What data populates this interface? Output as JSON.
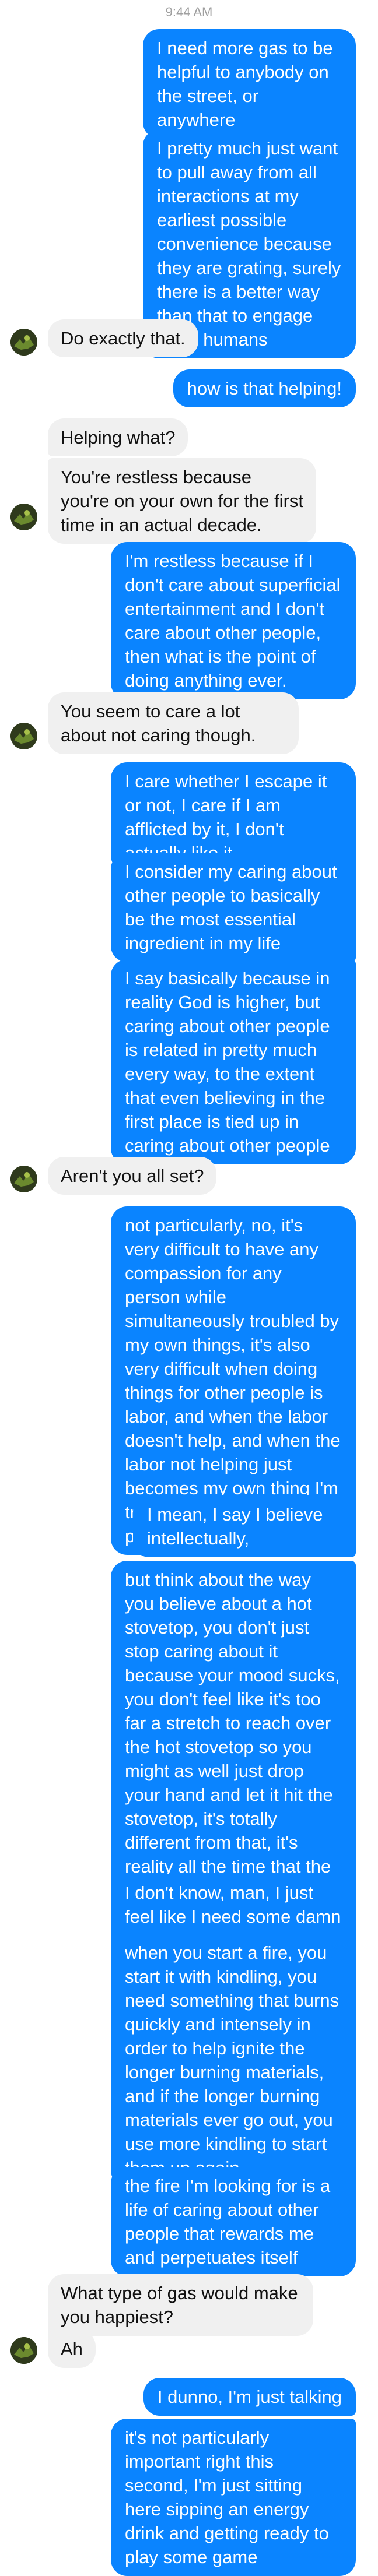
{
  "status": {
    "time": "9:44 AM"
  },
  "contact": {
    "avatar_icon": "contact-avatar-icon"
  },
  "colors": {
    "outgoing_bubble": "#0a84ff",
    "incoming_bubble": "#f0f0f0"
  },
  "messages": [
    {
      "sender": "me",
      "text": "I need more gas to be helpful to anybody on the street, or anywhere"
    },
    {
      "sender": "me",
      "text": "I pretty much just want to pull away from all interactions at my earliest possible convenience because they are grating, surely there is a better way than that to engage other humans"
    },
    {
      "sender": "them",
      "text": "Do exactly that."
    },
    {
      "sender": "me",
      "text": "how is that helping!"
    },
    {
      "sender": "them",
      "text": "Helping what?"
    },
    {
      "sender": "them",
      "text": "You're restless because you're on your own for the first time in an actual decade."
    },
    {
      "sender": "me",
      "text": "I'm restless because if I don't care about superficial entertainment and I don't care about other people, then what is the point of doing anything ever."
    },
    {
      "sender": "them",
      "text": "You seem to care a lot about not caring though."
    },
    {
      "sender": "me",
      "text": "I care whether I escape it or not, I care if I am afflicted by it, I don't actually like it"
    },
    {
      "sender": "me",
      "text": "I consider my caring about other people to basically be the most essential ingredient in my life"
    },
    {
      "sender": "me",
      "text": "I say basically because in reality God is higher, but caring about other people is related in pretty much every way, to the extent that even believing in the first place is tied up in caring about other people"
    },
    {
      "sender": "them",
      "text": "Aren't you all set?"
    },
    {
      "sender": "me",
      "text": "not particularly, no, it's very difficult to have any compassion for any person while simultaneously troubled by my own things, it's also very difficult when doing things for other people is labor, and when the labor doesn't help, and when the labor not helping just becomes my own thing I'm troubled by, I don't feel particularly set, no"
    },
    {
      "sender": "me",
      "text": "I mean, I say I believe intellectually,"
    },
    {
      "sender": "me",
      "text": "but think about the way you believe about a hot stovetop, you don't just stop caring about it because your mood sucks, you don't feel like it's too far a stretch to reach over the hot stovetop so you might as well just drop your hand and let it hit the stovetop, it's totally different from that, it's reality all the time that the stovetop is hot, and you always want to avoid it no matter what"
    },
    {
      "sender": "me",
      "text": "I don't know, man, I just feel like I need some damn gas"
    },
    {
      "sender": "me",
      "text": "when you start a fire, you start it with kindling, you need something that burns quickly and intensely in order to help ignite the longer burning materials, and if the longer burning materials ever go out, you use more kindling to start them up again"
    },
    {
      "sender": "me",
      "text": "the fire I'm looking for is a life of caring about other people that rewards me and perpetuates itself"
    },
    {
      "sender": "them",
      "text": "What type of gas would make you happiest?"
    },
    {
      "sender": "them",
      "text": "Ah"
    },
    {
      "sender": "me",
      "text": "I dunno, I'm just talking"
    },
    {
      "sender": "me",
      "text": "it's not particularly important right this second, I'm just sitting here sipping an energy drink and getting ready to play some game"
    }
  ]
}
